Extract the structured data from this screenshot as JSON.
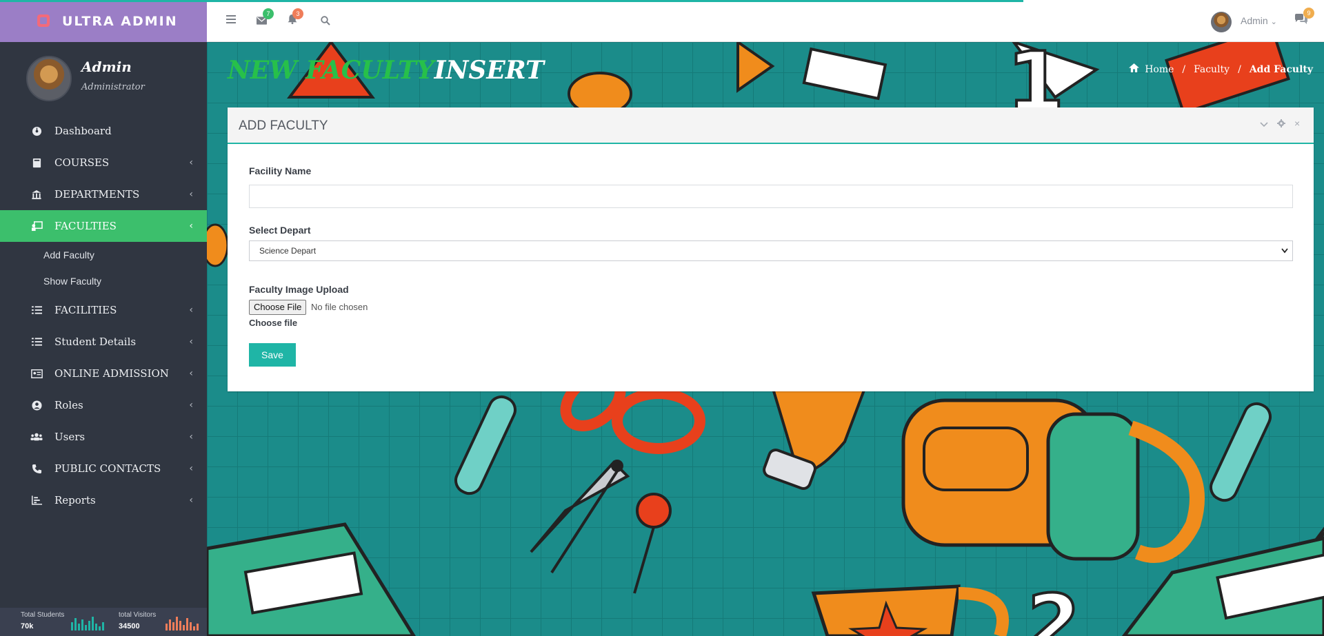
{
  "brand": {
    "name": "ULTRA ADMIN"
  },
  "profile": {
    "name": "Admin",
    "role": "Administrator"
  },
  "sidebar": {
    "items": [
      {
        "label": "Dashboard",
        "icon": "dashboard-icon",
        "chevron": ""
      },
      {
        "label": "COURSES",
        "icon": "book-icon",
        "chevron": "‹"
      },
      {
        "label": "DEPARTMENTS",
        "icon": "institution-icon",
        "chevron": "‹"
      },
      {
        "label": "FACULTIES",
        "icon": "teacher-icon",
        "chevron": "‹"
      },
      {
        "label": "FACILITIES",
        "icon": "list-icon",
        "chevron": "‹"
      },
      {
        "label": "Student Details",
        "icon": "list-icon",
        "chevron": "‹"
      },
      {
        "label": "ONLINE ADMISSION",
        "icon": "id-card-icon",
        "chevron": "‹"
      },
      {
        "label": "Roles",
        "icon": "user-circle-icon",
        "chevron": "‹"
      },
      {
        "label": "Users",
        "icon": "users-icon",
        "chevron": "‹"
      },
      {
        "label": "PUBLIC CONTACTS",
        "icon": "phone-icon",
        "chevron": "‹"
      },
      {
        "label": "Reports",
        "icon": "bar-chart-icon",
        "chevron": "‹"
      }
    ],
    "submenu": [
      "Add Faculty",
      "Show Faculty"
    ],
    "footer": {
      "students_label": "Total Students",
      "students_value": "70k",
      "visitors_label": "total Visitors",
      "visitors_value": "34500",
      "spark_students": [
        0.6,
        0.9,
        0.5,
        0.8,
        0.4,
        0.7,
        1.0,
        0.5,
        0.3,
        0.6
      ],
      "spark_visitors": [
        0.5,
        0.8,
        0.6,
        1.0,
        0.7,
        0.4,
        0.9,
        0.6,
        0.3,
        0.5
      ],
      "spark_students_color": "#1fb5a6",
      "spark_visitors_color": "#ef7d5a"
    }
  },
  "header": {
    "mail_badge": "7",
    "bell_badge": "3",
    "user_name": "Admin",
    "chat_badge": "9",
    "mail_badge_color": "#3cbf6c",
    "bell_badge_color": "#ef7d5a",
    "chat_badge_color": "#f0ad4e"
  },
  "page": {
    "title_part1": "NEW FACULTY",
    "title_part2": "INSERT",
    "breadcrumb": {
      "home": "Home",
      "section": "Faculty",
      "current": "Add Faculty",
      "separator": "/"
    }
  },
  "panel": {
    "title": "ADD FACULTY",
    "fields": {
      "name_label": "Facility Name",
      "name_value": "",
      "depart_label": "Select Depart",
      "depart_selected": "Science Depart",
      "image_label": "Faculty Image Upload",
      "file_button": "Choose File",
      "file_status": "No file chosen",
      "file_help": "Choose file"
    },
    "save_label": "Save"
  },
  "colors": {
    "accent": "#1fb5a6",
    "active_menu": "#3cbf6c",
    "sidebar_bg": "#303641",
    "brand_bg": "#9b7ec6"
  }
}
